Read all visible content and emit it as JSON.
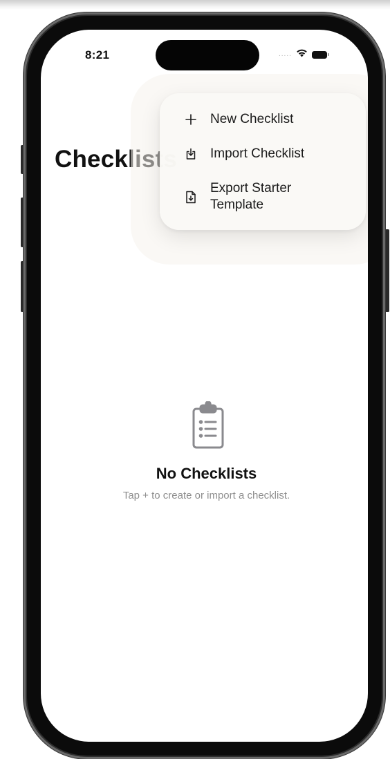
{
  "status_bar": {
    "time": "8:21",
    "signal_text": ".....",
    "icons": [
      "wifi-icon",
      "battery-icon"
    ]
  },
  "nav": {
    "large_title": "Checklists"
  },
  "menu": {
    "items": [
      {
        "label": "New Checklist",
        "icon": "plus-icon"
      },
      {
        "label": "Import Checklist",
        "icon": "tray-arrow-down-icon"
      },
      {
        "label_line1": "Export Starter",
        "label_line2": "Template",
        "icon": "document-arrow-down-icon"
      }
    ]
  },
  "empty_state": {
    "icon": "clipboard-list-icon",
    "title": "No Checklists",
    "subtitle": "Tap + to create or import a checklist."
  },
  "colors": {
    "text_primary": "#111111",
    "text_secondary": "#8e8e8e",
    "icon_gray": "#8a8a8e"
  }
}
